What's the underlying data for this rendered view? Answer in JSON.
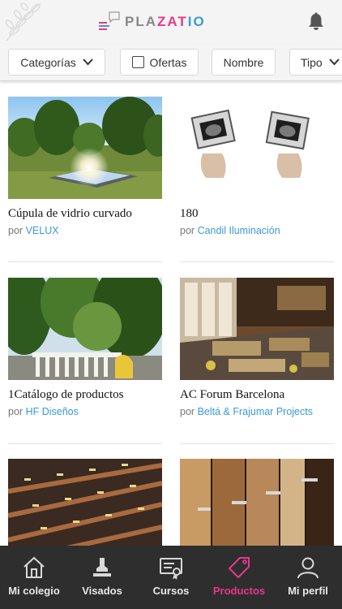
{
  "app": {
    "logo_prefix": "PLA",
    "logo_middle": "ZAT",
    "logo_suffix": "IO",
    "brand_pink": "#e8388a",
    "brand_blue": "#3a9ad9"
  },
  "filters": {
    "categories_label": "Categorías",
    "offers_label": "Ofertas",
    "offers_checked": false,
    "name_label": "Nombre",
    "type_label": "Tipo"
  },
  "products": [
    {
      "title": "Cúpula de vidrio curvado",
      "by_prefix": "por",
      "brand": "VELUX"
    },
    {
      "title": "180",
      "by_prefix": "por",
      "brand": "Candil Iluminación"
    },
    {
      "title": "1Catálogo de productos",
      "by_prefix": "por",
      "brand": "HF Diseños"
    },
    {
      "title": "AC Forum Barcelona",
      "by_prefix": "por",
      "brand": "Beltá & Frajumar Projects"
    },
    {
      "title": "",
      "by_prefix": "",
      "brand": ""
    },
    {
      "title": "",
      "by_prefix": "",
      "brand": ""
    }
  ],
  "nav": {
    "items": [
      {
        "label": "Mi colegio",
        "icon": "school-icon"
      },
      {
        "label": "Visados",
        "icon": "stamp-icon"
      },
      {
        "label": "Cursos",
        "icon": "certificate-icon"
      },
      {
        "label": "Productos",
        "icon": "tag-icon"
      },
      {
        "label": "Mi perfil",
        "icon": "user-icon"
      }
    ],
    "active": "Productos",
    "active_color": "#e8388a"
  }
}
